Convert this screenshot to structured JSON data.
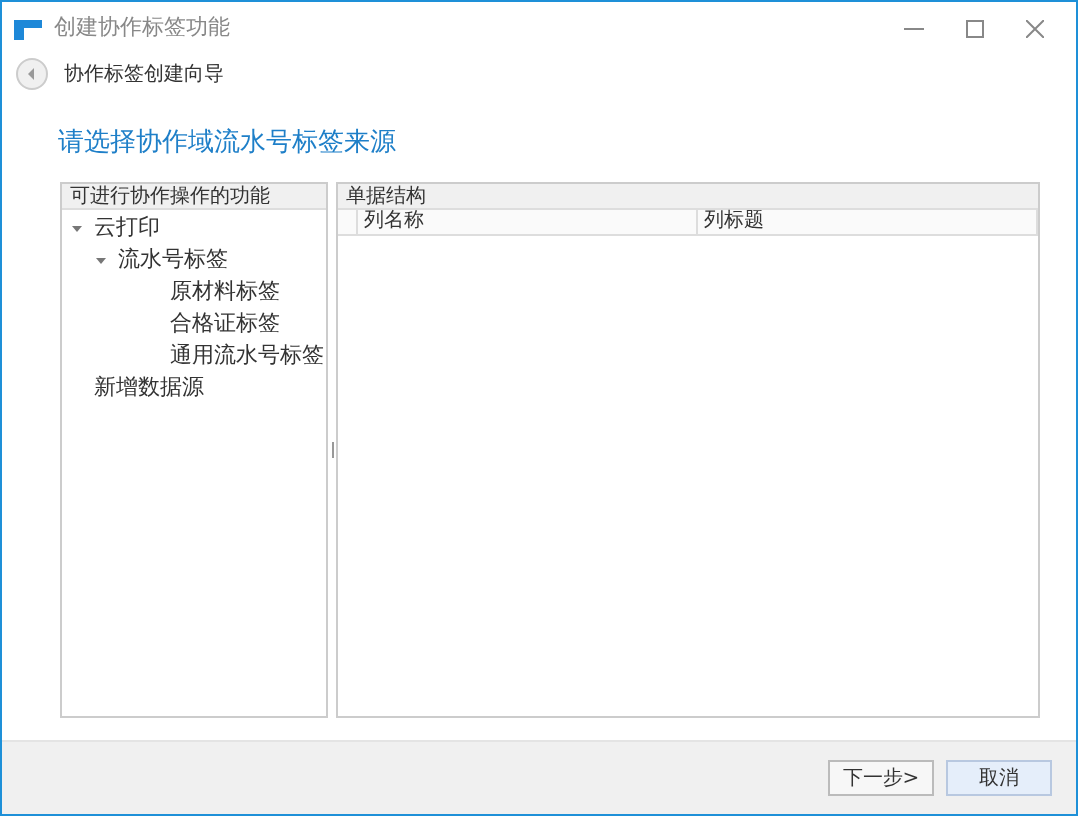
{
  "window": {
    "title": "创建协作标签功能"
  },
  "wizard": {
    "title": "协作标签创建向导"
  },
  "heading": "请选择协作域流水号标签来源",
  "left_panel": {
    "title": "可进行协作操作的功能",
    "tree": [
      {
        "label": "云打印",
        "expanded": true,
        "children": [
          {
            "label": "流水号标签",
            "expanded": true,
            "children": [
              {
                "label": "原材料标签"
              },
              {
                "label": "合格证标签"
              },
              {
                "label": "通用流水号标签"
              }
            ]
          }
        ]
      },
      {
        "label": "新增数据源"
      }
    ]
  },
  "right_panel": {
    "title": "单据结构",
    "columns": [
      "列名称",
      "列标题"
    ]
  },
  "buttons": [
    {
      "label": "下一步>",
      "kind": "default"
    },
    {
      "label": "取消",
      "kind": "primary"
    }
  ]
}
